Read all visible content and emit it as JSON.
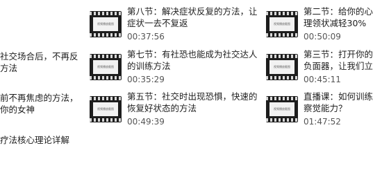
{
  "left_fragments": [
    "社交场合后，不再反",
    "方法",
    "前不再焦虑的方法，",
    "你的女神",
    "疗法核心理论详解"
  ],
  "thumbnail_text": "视频播放截图",
  "cards": [
    {
      "title": "第八节：解决症状反复的方法，让症状一去不复返",
      "duration": "00:37:56"
    },
    {
      "title": "第二节：给你的心理领状减轻30%",
      "duration": "00:50:09"
    },
    {
      "title": "第七节：有社恐也能成为社交达人的训练方法",
      "duration": "00:35:29"
    },
    {
      "title": "第三节：打开你的负面器，让我们立刻轻松起",
      "duration": "00:45:11"
    },
    {
      "title": "第五节：社交时出现恐惧，快速的恢复好状态的方法",
      "duration": "00:49:39"
    },
    {
      "title": "直播课：如何训练察觉能力？",
      "duration": "01:47:52"
    }
  ]
}
